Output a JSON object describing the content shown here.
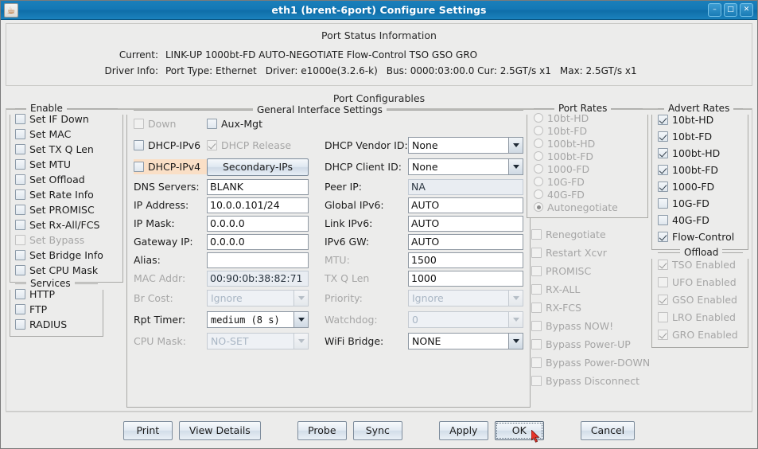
{
  "window": {
    "title": "eth1 (brent-6port) Configure Settings",
    "icon": "java-cup-icon",
    "buttons": {
      "minimize": "–",
      "maximize": "□",
      "close": "✕"
    }
  },
  "status": {
    "title": "Port Status Information",
    "current_label": "Current:",
    "current_value": "LINK-UP 1000bt-FD AUTO-NEGOTIATE Flow-Control TSO GSO GRO",
    "driver_label": "Driver Info:",
    "driver_parts": [
      "Port Type: Ethernet",
      "Driver: e1000e(3.2.6-k)",
      "Bus: 0000:03:00.0 Cur: 2.5GT/s x1",
      "Max: 2.5GT/s x1"
    ]
  },
  "configurables_title": "Port Configurables",
  "enable": {
    "title": "Enable",
    "items": [
      {
        "label": "Set IF Down",
        "checked": false,
        "disabled": false
      },
      {
        "label": "Set MAC",
        "checked": false,
        "disabled": false
      },
      {
        "label": "Set TX Q Len",
        "checked": false,
        "disabled": false
      },
      {
        "label": "Set MTU",
        "checked": false,
        "disabled": false
      },
      {
        "label": "Set Offload",
        "checked": false,
        "disabled": false
      },
      {
        "label": "Set Rate Info",
        "checked": false,
        "disabled": false
      },
      {
        "label": "Set PROMISC",
        "checked": false,
        "disabled": false
      },
      {
        "label": "Set Rx-All/FCS",
        "checked": false,
        "disabled": false
      },
      {
        "label": "Set Bypass",
        "checked": false,
        "disabled": true
      },
      {
        "label": "Set Bridge Info",
        "checked": false,
        "disabled": false
      },
      {
        "label": "Set CPU Mask",
        "checked": false,
        "disabled": false
      }
    ]
  },
  "services": {
    "title": "Services",
    "items": [
      {
        "label": "HTTP",
        "checked": false,
        "disabled": false
      },
      {
        "label": "FTP",
        "checked": false,
        "disabled": false
      },
      {
        "label": "RADIUS",
        "checked": false,
        "disabled": false
      }
    ]
  },
  "general": {
    "title": "General Interface Settings",
    "checks": {
      "down": {
        "label": "Down",
        "checked": false,
        "disabled": true
      },
      "aux_mgt": {
        "label": "Aux-Mgt",
        "checked": false,
        "disabled": false
      },
      "dhcp_ipv6": {
        "label": "DHCP-IPv6",
        "checked": false,
        "disabled": false
      },
      "dhcp_release": {
        "label": "DHCP Release",
        "checked": true,
        "disabled": true
      },
      "dhcp_ipv4": {
        "label": "DHCP-IPv4",
        "checked": false,
        "disabled": false,
        "highlight": true
      }
    },
    "secondary_ips_button": "Secondary-IPs",
    "left_fields": [
      {
        "label": "DNS Servers:",
        "value": "BLANK",
        "readonly": false,
        "label_dim": false
      },
      {
        "label": "IP Address:",
        "value": "10.0.0.101/24",
        "readonly": false,
        "label_dim": false
      },
      {
        "label": "IP Mask:",
        "value": "0.0.0.0",
        "readonly": false,
        "label_dim": false
      },
      {
        "label": "Gateway IP:",
        "value": "0.0.0.0",
        "readonly": false,
        "label_dim": false
      },
      {
        "label": "Alias:",
        "value": "",
        "readonly": false,
        "label_dim": false
      },
      {
        "label": "MAC Addr:",
        "value": "00:90:0b:38:82:71",
        "readonly": true,
        "label_dim": true
      }
    ],
    "right_fields": [
      {
        "label": "Peer IP:",
        "value": "NA",
        "readonly": true,
        "label_dim": false
      },
      {
        "label": "Global IPv6:",
        "value": "AUTO",
        "readonly": false,
        "label_dim": false
      },
      {
        "label": "Link IPv6:",
        "value": "AUTO",
        "readonly": false,
        "label_dim": false
      },
      {
        "label": "IPv6 GW:",
        "value": "AUTO",
        "readonly": false,
        "label_dim": false
      },
      {
        "label": "MTU:",
        "value": "1500",
        "readonly": false,
        "label_dim": true
      },
      {
        "label": "TX Q Len",
        "value": "1000",
        "readonly": false,
        "label_dim": true
      }
    ],
    "left_combos": [
      {
        "label": "Br Cost:",
        "value": "Ignore",
        "disabled": true,
        "mono": false
      },
      {
        "label": "Rpt Timer:",
        "value": "medium  (8 s)",
        "disabled": false,
        "mono": true
      },
      {
        "label": "CPU Mask:",
        "value": "NO-SET",
        "disabled": true,
        "mono": false
      }
    ],
    "right_combos": [
      {
        "label": "Priority:",
        "value": "Ignore",
        "disabled": true,
        "mono": false
      },
      {
        "label": "Watchdog:",
        "value": "0",
        "disabled": true,
        "mono": false
      },
      {
        "label": "WiFi Bridge:",
        "value": "NONE",
        "disabled": false,
        "mono": false
      }
    ],
    "dhcp_vendor": {
      "label": "DHCP Vendor ID:",
      "value": "None",
      "disabled": false
    },
    "dhcp_client": {
      "label": "DHCP Client ID:",
      "value": "None",
      "disabled": false
    }
  },
  "port_rates": {
    "title": "Port Rates",
    "items": [
      {
        "label": "10bt-HD",
        "selected": false
      },
      {
        "label": "10bt-FD",
        "selected": false
      },
      {
        "label": "100bt-HD",
        "selected": false
      },
      {
        "label": "100bt-FD",
        "selected": false
      },
      {
        "label": "1000-FD",
        "selected": false
      },
      {
        "label": "10G-FD",
        "selected": false
      },
      {
        "label": "40G-FD",
        "selected": false
      },
      {
        "label": "Autonegotiate",
        "selected": true
      }
    ]
  },
  "misc_checks": [
    {
      "label": "Renegotiate",
      "checked": false,
      "disabled": true
    },
    {
      "label": "Restart Xcvr",
      "checked": false,
      "disabled": true
    },
    {
      "label": "PROMISC",
      "checked": false,
      "disabled": true
    },
    {
      "label": "RX-ALL",
      "checked": false,
      "disabled": true
    },
    {
      "label": "RX-FCS",
      "checked": false,
      "disabled": true
    },
    {
      "label": "Bypass NOW!",
      "checked": false,
      "disabled": true
    },
    {
      "label": "Bypass Power-UP",
      "checked": false,
      "disabled": true
    },
    {
      "label": "Bypass Power-DOWN",
      "checked": false,
      "disabled": true
    },
    {
      "label": "Bypass Disconnect",
      "checked": false,
      "disabled": true
    }
  ],
  "advert_rates": {
    "title": "Advert Rates",
    "items": [
      {
        "label": "10bt-HD",
        "checked": true,
        "disabled": false
      },
      {
        "label": "10bt-FD",
        "checked": true,
        "disabled": false
      },
      {
        "label": "100bt-HD",
        "checked": true,
        "disabled": false
      },
      {
        "label": "100bt-FD",
        "checked": true,
        "disabled": false
      },
      {
        "label": "1000-FD",
        "checked": true,
        "disabled": false
      },
      {
        "label": "10G-FD",
        "checked": false,
        "disabled": false
      },
      {
        "label": "40G-FD",
        "checked": false,
        "disabled": false
      },
      {
        "label": "Flow-Control",
        "checked": true,
        "disabled": false
      }
    ]
  },
  "offload": {
    "title": "Offload",
    "items": [
      {
        "label": "TSO Enabled",
        "checked": true,
        "disabled": true
      },
      {
        "label": "UFO Enabled",
        "checked": false,
        "disabled": true
      },
      {
        "label": "GSO Enabled",
        "checked": true,
        "disabled": true
      },
      {
        "label": "LRO Enabled",
        "checked": false,
        "disabled": true
      },
      {
        "label": "GRO Enabled",
        "checked": true,
        "disabled": true
      }
    ]
  },
  "footer_buttons": [
    {
      "label": "Print",
      "focused": false
    },
    {
      "label": "View Details",
      "focused": false
    },
    {
      "label": "Probe",
      "focused": false
    },
    {
      "label": "Sync",
      "focused": false
    },
    {
      "label": "Apply",
      "focused": false
    },
    {
      "label": "OK",
      "focused": true
    },
    {
      "label": "Cancel",
      "focused": false
    }
  ],
  "colors": {
    "titlebar": "#1378b5",
    "panel": "#ececeb",
    "highlight": "#fadfc6",
    "disabled_text": "#a6a6a6"
  }
}
